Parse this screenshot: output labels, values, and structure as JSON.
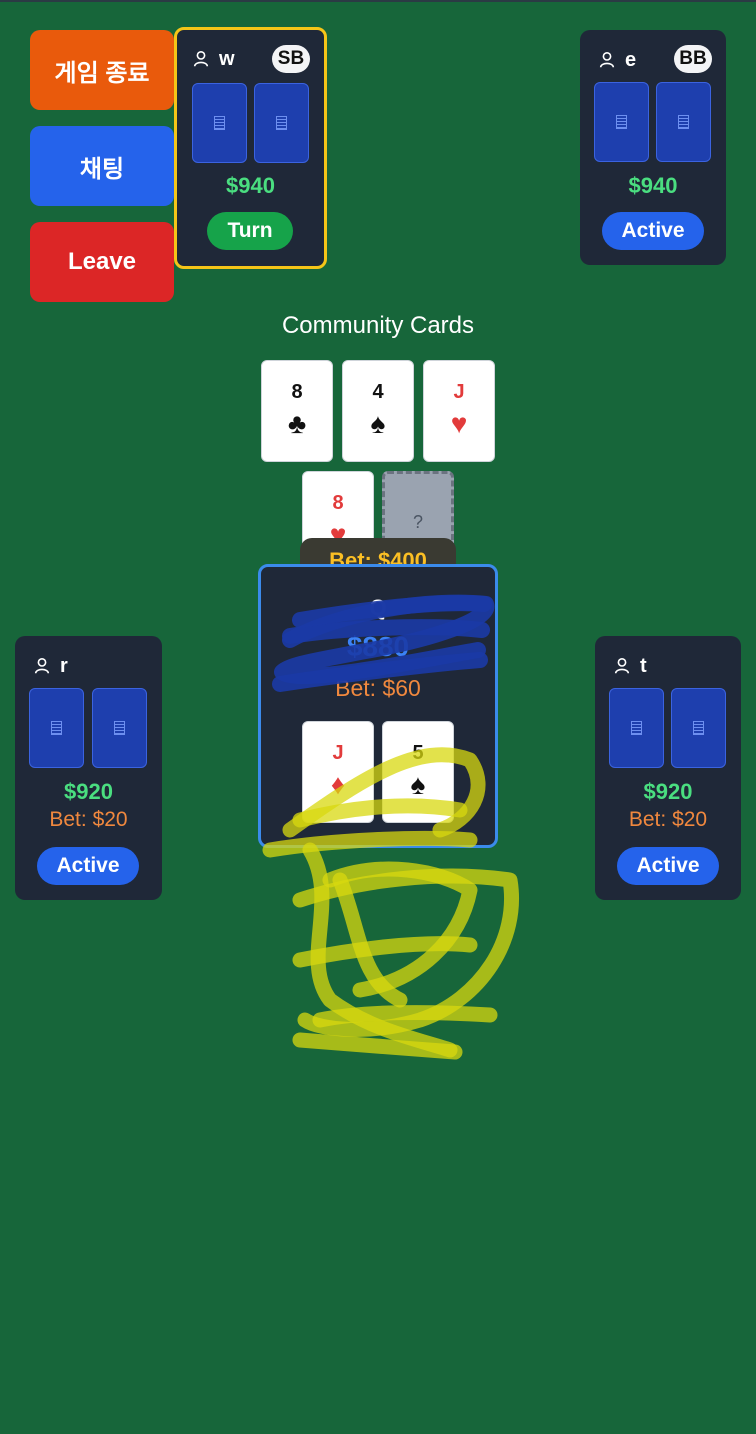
{
  "buttons": {
    "end_game": "게임 종료",
    "chat": "채팅",
    "leave": "Leave"
  },
  "players": {
    "w": {
      "name": "w",
      "badge": "SB",
      "money": "$940",
      "status": "Turn"
    },
    "e": {
      "name": "e",
      "badge": "BB",
      "money": "$940",
      "status": "Active"
    },
    "r": {
      "name": "r",
      "money": "$920",
      "bet": "Bet: $20",
      "status": "Active"
    },
    "t": {
      "name": "t",
      "money": "$920",
      "bet": "Bet: $20",
      "status": "Active"
    }
  },
  "community": {
    "title": "Community Cards",
    "cards": [
      {
        "rank": "8",
        "suit": "♣"
      },
      {
        "rank": "4",
        "suit": "♠"
      },
      {
        "rank": "J",
        "suit": "♥"
      },
      {
        "rank": "8",
        "suit": "♥"
      },
      {
        "rank": "?",
        "suit": ""
      }
    ]
  },
  "pot": {
    "label": "Bet: $400"
  },
  "me": {
    "name": "Q",
    "money": "$880",
    "bet": "Bet: $60",
    "cards": [
      {
        "rank": "J",
        "suit": "♦"
      },
      {
        "rank": "5",
        "suit": "♠"
      }
    ]
  },
  "colors": {
    "table": "#17663a",
    "panel": "#1f2838",
    "money": "#4ade80",
    "bet": "#f0883e",
    "turn_border": "#f5c518",
    "active": "#2563eb",
    "turn": "#16a34a"
  }
}
